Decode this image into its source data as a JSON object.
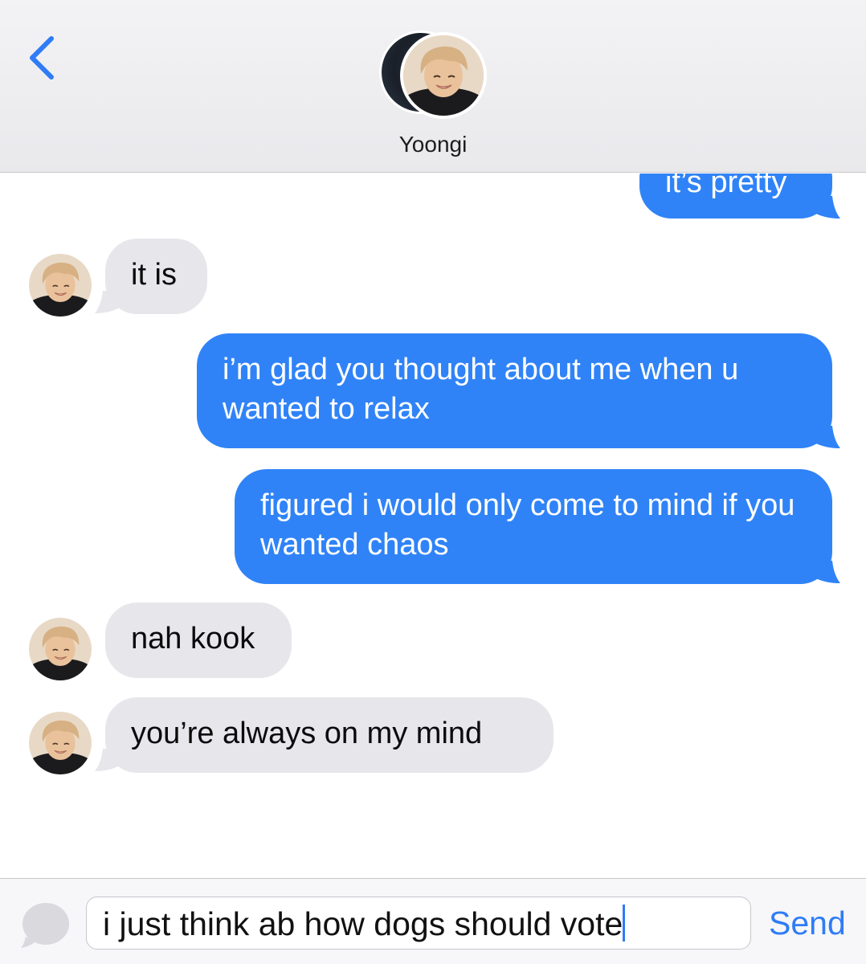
{
  "contact": {
    "name": "Yoongi"
  },
  "colors": {
    "outgoing": "#3083f7",
    "incoming": "#e6e6eb",
    "accent": "#2f7cf6"
  },
  "messages": [
    {
      "direction": "outgoing",
      "text": "it’s pretty"
    },
    {
      "direction": "incoming",
      "text": "it is"
    },
    {
      "direction": "outgoing",
      "text": "i’m glad you thought about me when u wanted to relax"
    },
    {
      "direction": "outgoing",
      "text": "figured i would only come to mind if you wanted chaos"
    },
    {
      "direction": "incoming",
      "text": "nah kook"
    },
    {
      "direction": "incoming",
      "text": "you’re always on my mind"
    }
  ],
  "composer": {
    "value": "i just think ab how dogs should vote",
    "send_label": "Send"
  },
  "icons": {
    "back": "chevron-left-icon",
    "camera": "camera-icon"
  }
}
